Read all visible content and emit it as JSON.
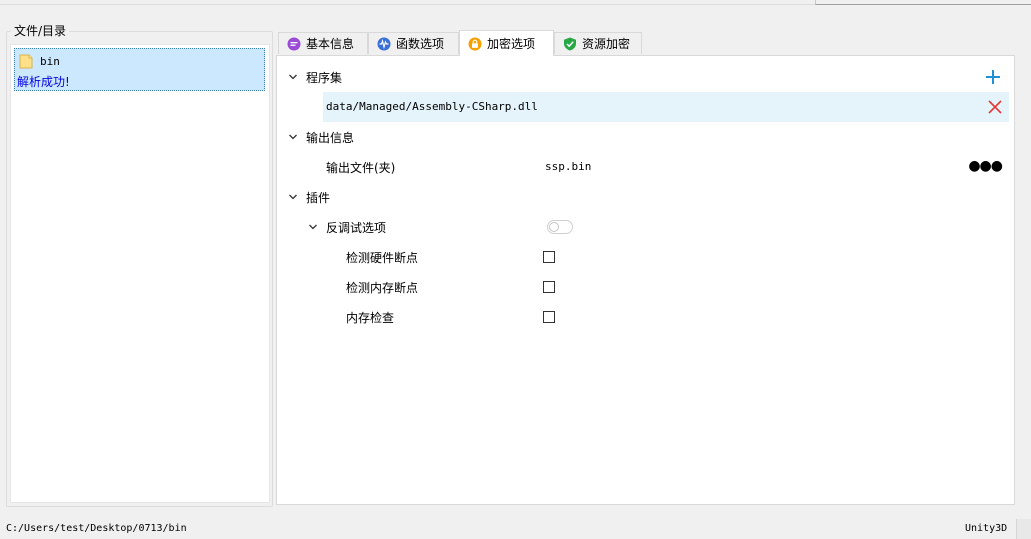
{
  "left_panel": {
    "group_title": "文件/目录",
    "tree_item": {
      "label": "bin",
      "status": "解析成功!"
    }
  },
  "tabs": [
    {
      "label": "基本信息",
      "icon": "chat-bubble-icon",
      "color": "#9a4cd6"
    },
    {
      "label": "函数选项",
      "icon": "waveform-icon",
      "color": "#3a6fd8"
    },
    {
      "label": "加密选项",
      "icon": "lock-icon",
      "color": "#f5a000",
      "active": true
    },
    {
      "label": "资源加密",
      "icon": "shield-check-icon",
      "color": "#28a745"
    }
  ],
  "panel": {
    "assembly": {
      "label": "程序集",
      "path": "data/Managed/Assembly-CSharp.dll",
      "add_icon": "plus-icon",
      "remove_icon": "close-icon"
    },
    "output": {
      "label": "输出信息",
      "field_label": "输出文件(夹)",
      "field_value": "ssp.bin",
      "more_icon": "ellipsis-icon"
    },
    "plugins": {
      "label": "插件",
      "anti_debug": {
        "label": "反调试选项",
        "options": [
          {
            "label": "检测硬件断点",
            "checked": false
          },
          {
            "label": "检测内存断点",
            "checked": false
          },
          {
            "label": "内存检查",
            "checked": false
          }
        ]
      }
    }
  },
  "status_bar": {
    "path": "C:/Users/test/Desktop/0713/bin",
    "engine": "Unity3D"
  },
  "colors": {
    "accent_blue": "#1e90d6",
    "remove_red": "#e53935",
    "selection": "#cce8ff"
  }
}
